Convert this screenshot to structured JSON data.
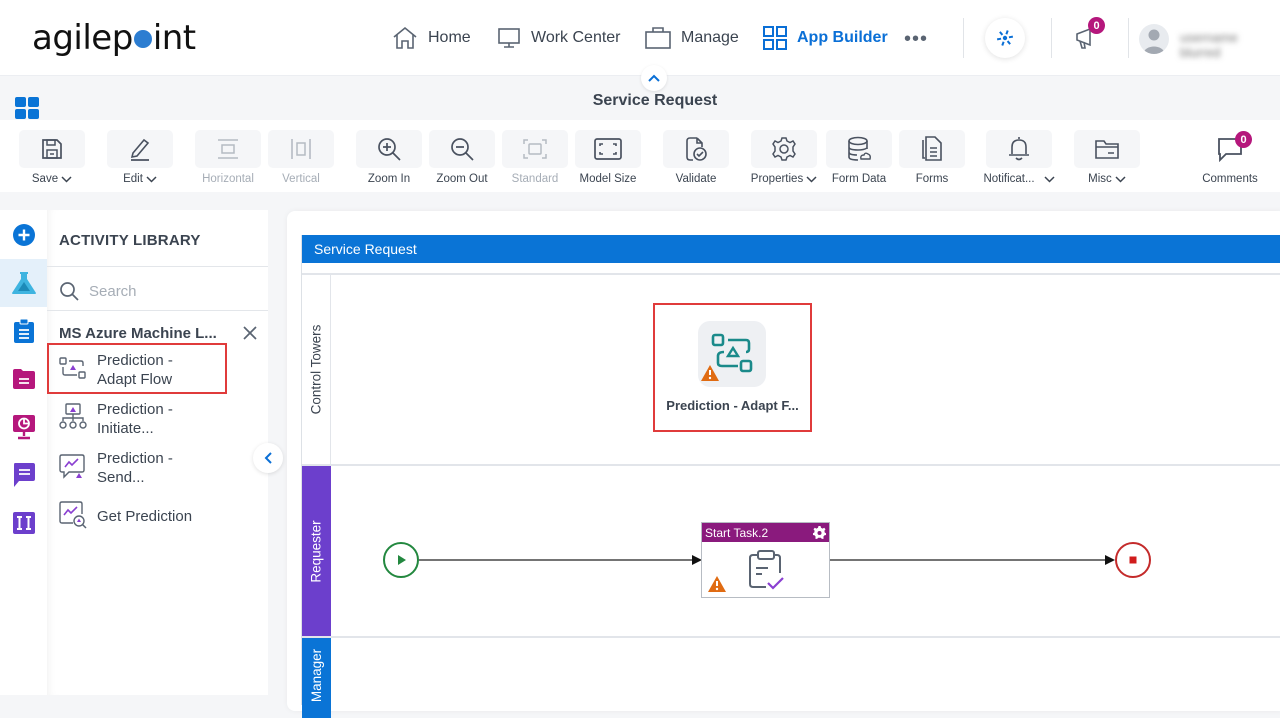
{
  "topnav": {
    "logo": {
      "prefix": "agilep",
      "suffix": "int"
    },
    "items": [
      {
        "label": "Home",
        "icon": "home-icon"
      },
      {
        "label": "Work Center",
        "icon": "monitor-icon"
      },
      {
        "label": "Manage",
        "icon": "briefcase-icon"
      },
      {
        "label": "App Builder",
        "icon": "grid-icon",
        "active": true
      }
    ],
    "more_label": "•••",
    "notifications_count": "0",
    "user_name": "username blurred"
  },
  "page": {
    "title": "Service Request"
  },
  "toolbar": {
    "items": [
      {
        "label": "Save",
        "dropdown": true,
        "enabled": true,
        "icon": "save-icon"
      },
      {
        "label": "Edit",
        "dropdown": true,
        "enabled": true,
        "icon": "edit-icon"
      },
      {
        "label": "Horizontal",
        "enabled": false,
        "icon": "horizontal-icon"
      },
      {
        "label": "Vertical",
        "enabled": false,
        "icon": "vertical-icon"
      },
      {
        "label": "Zoom In",
        "enabled": true,
        "icon": "zoom-in-icon"
      },
      {
        "label": "Zoom Out",
        "enabled": true,
        "icon": "zoom-out-icon"
      },
      {
        "label": "Standard",
        "enabled": false,
        "icon": "standard-icon"
      },
      {
        "label": "Model Size",
        "enabled": true,
        "icon": "model-size-icon"
      },
      {
        "label": "Validate",
        "enabled": true,
        "icon": "validate-icon"
      },
      {
        "label": "Properties",
        "dropdown": true,
        "enabled": true,
        "icon": "gear-icon"
      },
      {
        "label": "Form Data",
        "enabled": true,
        "icon": "database-icon"
      },
      {
        "label": "Forms",
        "enabled": true,
        "icon": "forms-icon"
      },
      {
        "label": "Notificat...",
        "dropdown": true,
        "enabled": true,
        "icon": "bell-icon"
      },
      {
        "label": "Misc",
        "dropdown": true,
        "enabled": true,
        "icon": "folder-icon"
      },
      {
        "label": "Comments",
        "enabled": true,
        "icon": "comment-icon",
        "badge": "0"
      }
    ]
  },
  "rail": {
    "items": [
      {
        "name": "add",
        "color": "#0a74d6"
      },
      {
        "name": "activity-library",
        "color": "#2a9fd0",
        "active": true
      },
      {
        "name": "clipboard",
        "color": "#0a74d6"
      },
      {
        "name": "documents",
        "color": "#b5177c"
      },
      {
        "name": "dashboard",
        "color": "#b5177c"
      },
      {
        "name": "messages",
        "color": "#6c3fcc"
      },
      {
        "name": "integration",
        "color": "#6c3fcc"
      }
    ]
  },
  "library": {
    "title": "ACTIVITY LIBRARY",
    "search_placeholder": "Search",
    "category": "MS Azure Machine L...",
    "items": [
      {
        "line1": "Prediction -",
        "line2": "Adapt Flow",
        "highlighted": true
      },
      {
        "line1": "Prediction -",
        "line2": "Initiate..."
      },
      {
        "line1": "Prediction -",
        "line2": "Send..."
      },
      {
        "line1": "Get Prediction",
        "line2": ""
      }
    ]
  },
  "canvas": {
    "pool_title": "Service Request",
    "lanes": [
      {
        "label": "Control Towers",
        "style": "plain"
      },
      {
        "label": "Requester",
        "style": "purple"
      },
      {
        "label": "Manager",
        "style": "blue"
      }
    ],
    "shapes": {
      "adapt_flow": {
        "label": "Prediction - Adapt F...",
        "warning": true
      },
      "task": {
        "title": "Start Task.2",
        "warning": true
      }
    },
    "colors": {
      "start": "#23883f",
      "end": "#c42b2b",
      "warning": "#e06b12",
      "task_header": "#8a1a7d",
      "highlight": "#e03b3b"
    }
  }
}
